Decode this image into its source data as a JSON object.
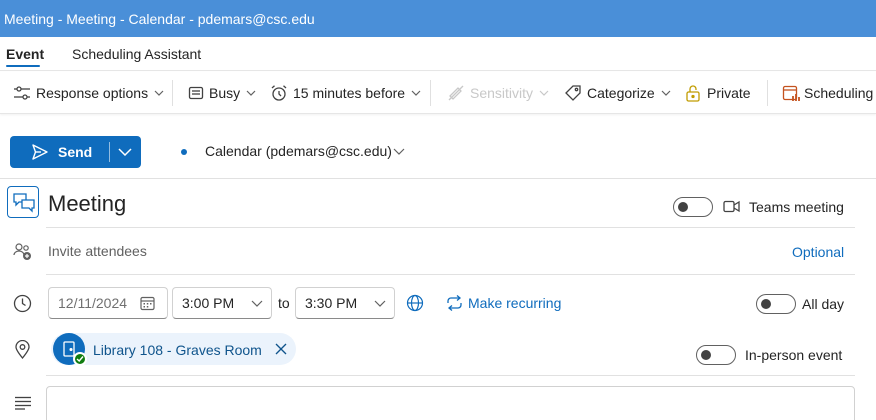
{
  "window": {
    "title": "Meeting - Meeting - Calendar - pdemars@csc.edu"
  },
  "tabs": [
    {
      "label": "Event",
      "active": true
    },
    {
      "label": "Scheduling Assistant",
      "active": false
    }
  ],
  "toolbar": {
    "response_options": "Response options",
    "show_as": "Busy",
    "reminder": "15 minutes before",
    "sensitivity": "Sensitivity",
    "categorize": "Categorize",
    "private": "Private",
    "scheduling": "Scheduling"
  },
  "send": {
    "label": "Send"
  },
  "calendar": {
    "label": "Calendar (pdemars@csc.edu)"
  },
  "event": {
    "title": "Meeting",
    "teams_meeting_label": "Teams meeting",
    "teams_meeting_on": false
  },
  "attendees": {
    "placeholder": "Invite attendees",
    "optional_label": "Optional"
  },
  "time": {
    "date": "12/11/2024",
    "start": "3:00 PM",
    "to_label": "to",
    "end": "3:30 PM",
    "make_recurring": "Make recurring",
    "all_day_label": "All day",
    "all_day_on": false
  },
  "location": {
    "room": "Library 108 - Graves Room",
    "in_person_label": "In-person event",
    "in_person_on": false
  },
  "colors": {
    "title_bar": "#4a8fd8",
    "accent": "#0f6cbd",
    "chip_bg": "#ebf3fc",
    "available_green": "#107c10"
  }
}
